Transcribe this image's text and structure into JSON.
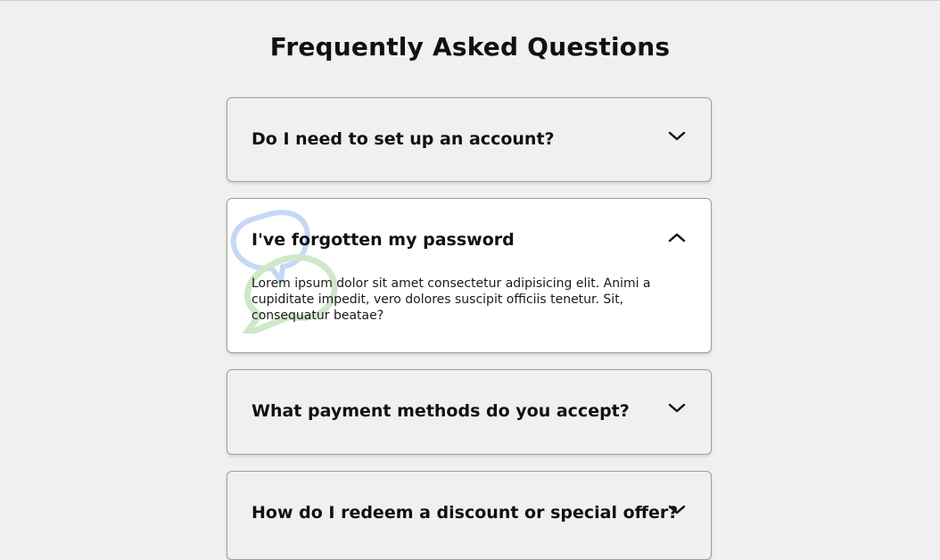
{
  "page": {
    "title": "Frequently Asked Questions"
  },
  "faqs": [
    {
      "question": "Do I need to set up an account?",
      "expanded": false,
      "toggle_icon": "chevron-down-icon"
    },
    {
      "question": "I've forgotten my password",
      "answer": "Lorem ipsum dolor sit amet consectetur adipisicing elit. Animi a cupiditate impedit, vero dolores suscipit officiis tenetur. Sit, consequatur beatae?",
      "expanded": true,
      "toggle_icon": "chevron-up-icon"
    },
    {
      "question": "What payment methods do you accept?",
      "expanded": false,
      "toggle_icon": "chevron-down-icon"
    },
    {
      "question": "How do I redeem a discount or special offer?",
      "expanded": false,
      "toggle_icon": "chevron-down-icon"
    }
  ],
  "colors": {
    "background": "#f0f0f0",
    "active_card": "#ffffff",
    "border": "#9e9e9e",
    "bubble_blue": "#c5d8f5",
    "bubble_green": "#cfe8c7"
  },
  "decorations": {
    "active_card_icon": "chat-bubbles-icon"
  }
}
